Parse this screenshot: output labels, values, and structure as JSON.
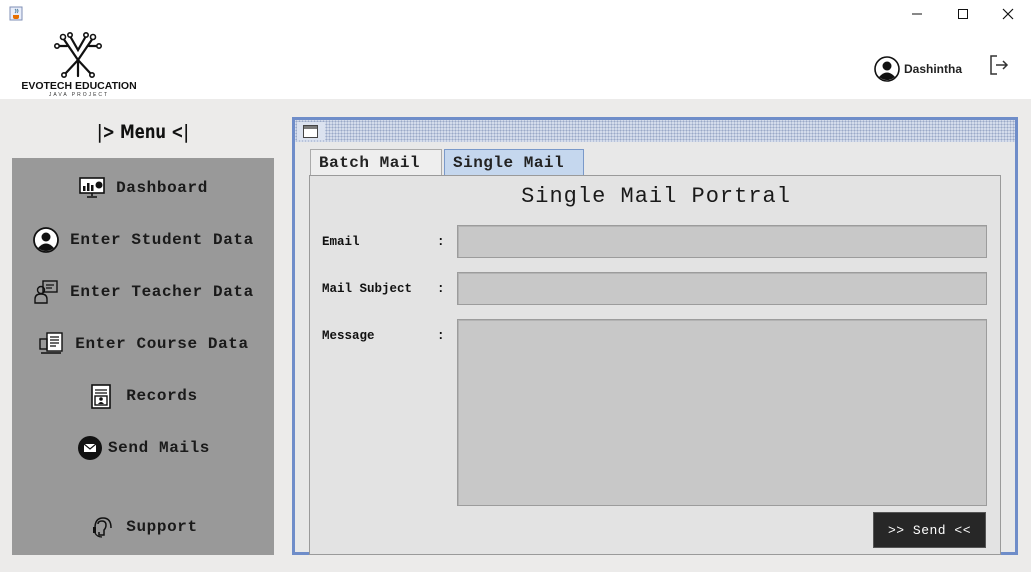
{
  "window": {
    "app_icon": "java-cup-icon",
    "controls": {
      "minimize": "minimize-icon",
      "maximize": "maximize-icon",
      "close": "close-icon"
    }
  },
  "header": {
    "logo_title": "EVOTECH EDUCATION",
    "logo_subtitle": "JAVA PROJECT",
    "user_name": "Dashintha",
    "user_icon": "user-avatar-icon",
    "logout_icon": "logout-icon"
  },
  "sidebar": {
    "title": "|> Menu <|",
    "items": [
      {
        "label": "Dashboard",
        "icon": "dashboard-monitor-icon"
      },
      {
        "label": "Enter Student Data",
        "icon": "student-icon"
      },
      {
        "label": "Enter Teacher Data",
        "icon": "teacher-icon"
      },
      {
        "label": "Enter Course Data",
        "icon": "course-icon"
      },
      {
        "label": "Records",
        "icon": "records-icon"
      },
      {
        "label": "Send Mails",
        "icon": "mail-icon"
      },
      {
        "label": "Support",
        "icon": "support-headset-icon"
      }
    ]
  },
  "mail_frame": {
    "tabs": [
      {
        "label": "Batch Mail",
        "selected": false
      },
      {
        "label": "Single Mail",
        "selected": true
      }
    ],
    "panel_title": "Single Mail Portral",
    "fields": {
      "email_label": "Email",
      "subject_label": "Mail Subject",
      "message_label": "Message",
      "separator": ":",
      "email_value": "",
      "subject_value": "",
      "message_value": ""
    },
    "send_label": ">> Send <<"
  },
  "colors": {
    "sidebar_bg": "#999999",
    "content_bg": "#ecebea",
    "frame_border": "#6f8dc9",
    "selected_tab": "#c5d7ee",
    "send_button": "#272727"
  }
}
